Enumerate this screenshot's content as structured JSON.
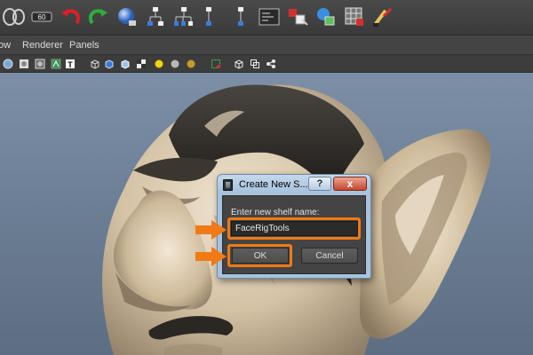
{
  "shelf": {
    "tools": [
      {
        "icon": "show-hide-icon"
      },
      {
        "icon": "wire-binding-icon"
      },
      {
        "icon": "undo-icon"
      },
      {
        "icon": "redo-icon"
      },
      {
        "icon": "sphere-icon"
      },
      {
        "icon": "hierarchy-icon"
      },
      {
        "icon": "hierarchy-icon"
      },
      {
        "icon": "hierarchy-icon"
      },
      {
        "icon": "hierarchy-icon"
      },
      {
        "icon": "editor-icon"
      },
      {
        "icon": "select-icon"
      },
      {
        "icon": "paint-icon"
      },
      {
        "icon": "grid-icon"
      },
      {
        "icon": "brush-icon"
      }
    ]
  },
  "menubar": {
    "items": [
      "ow",
      "Renderer",
      "Panels"
    ]
  },
  "panel_toolbar": {
    "icons": [
      "shaded-icon",
      "smooth-icon",
      "wire-icon",
      "texture-icon",
      "wireframe-cube-icon",
      "solid-cube-icon",
      "cube-icon",
      "checker-icon",
      "light-icon",
      "grey-ball-icon",
      "gold-ball-icon",
      "frame-select-icon",
      "cube-outline-icon",
      "camera-icon",
      "share-icon"
    ]
  },
  "dialog": {
    "title": "Create New S...",
    "help_label": "?",
    "close_label": "x",
    "prompt": "Enter new shelf name:",
    "input_value": "FaceRigTools",
    "ok_label": "OK",
    "cancel_label": "Cancel"
  },
  "colors": {
    "highlight": "#f07a16",
    "viewport_top": "#7d8fa6",
    "dialog_frame": "#a9c3de"
  }
}
